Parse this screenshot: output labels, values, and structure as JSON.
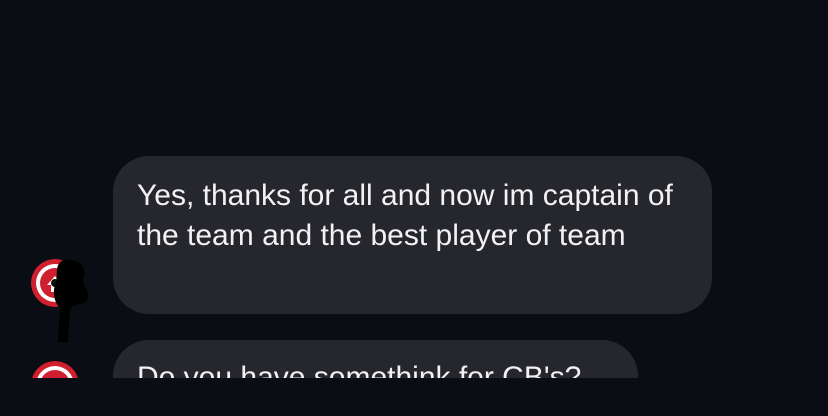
{
  "conversation": {
    "messages": [
      {
        "text": "Yes, thanks for all and now im captain of the team and the best player of team"
      },
      {
        "text": "Do you have somethink for CB's?"
      }
    ]
  },
  "colors": {
    "background": "#0b0d14",
    "bubble": "#26272d",
    "text": "#f2f2f5",
    "avatar_ring": "#d0202f"
  },
  "icons": {
    "avatar": "club-crest-avatar",
    "redaction": "black-scribble"
  }
}
